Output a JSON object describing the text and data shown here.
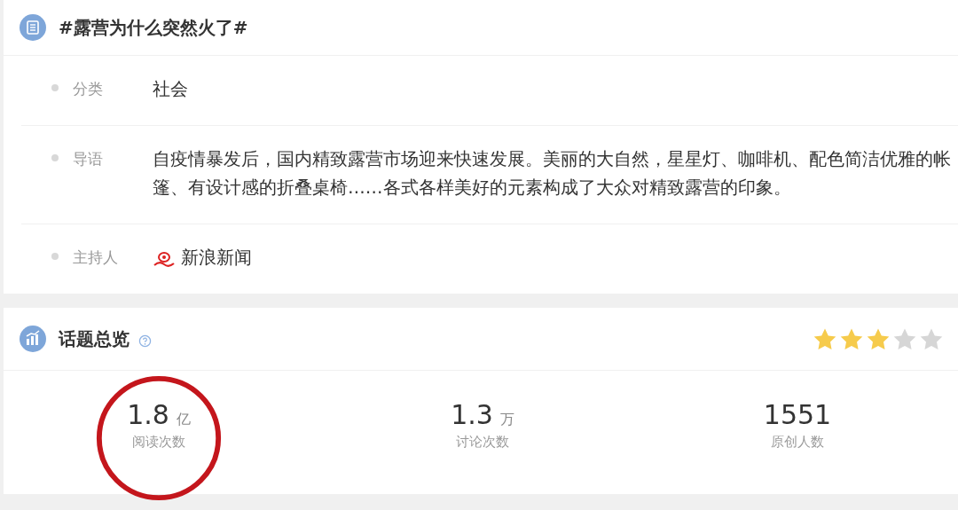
{
  "topic": {
    "title": "#露营为什么突然火了#",
    "fields": [
      {
        "label": "分类",
        "value": "社会",
        "kind": "text"
      },
      {
        "label": "导语",
        "value": "自疫情暴发后，国内精致露营市场迎来快速发展。美丽的大自然，星星灯、咖啡机、配色简洁优雅的帐篷、有设计感的折叠桌椅……各式各样美好的元素构成了大众对精致露营的印象。",
        "kind": "text"
      },
      {
        "label": "主持人",
        "value": "新浪新闻",
        "kind": "host"
      }
    ]
  },
  "overview": {
    "title": "话题总览",
    "stars": 3,
    "stats": [
      {
        "number": "1.8",
        "unit": "亿",
        "label": "阅读次数",
        "circled": true
      },
      {
        "number": "1.3",
        "unit": "万",
        "label": "讨论次数",
        "circled": false
      },
      {
        "number": "1551",
        "label": "原创人数",
        "circled": false
      }
    ]
  }
}
